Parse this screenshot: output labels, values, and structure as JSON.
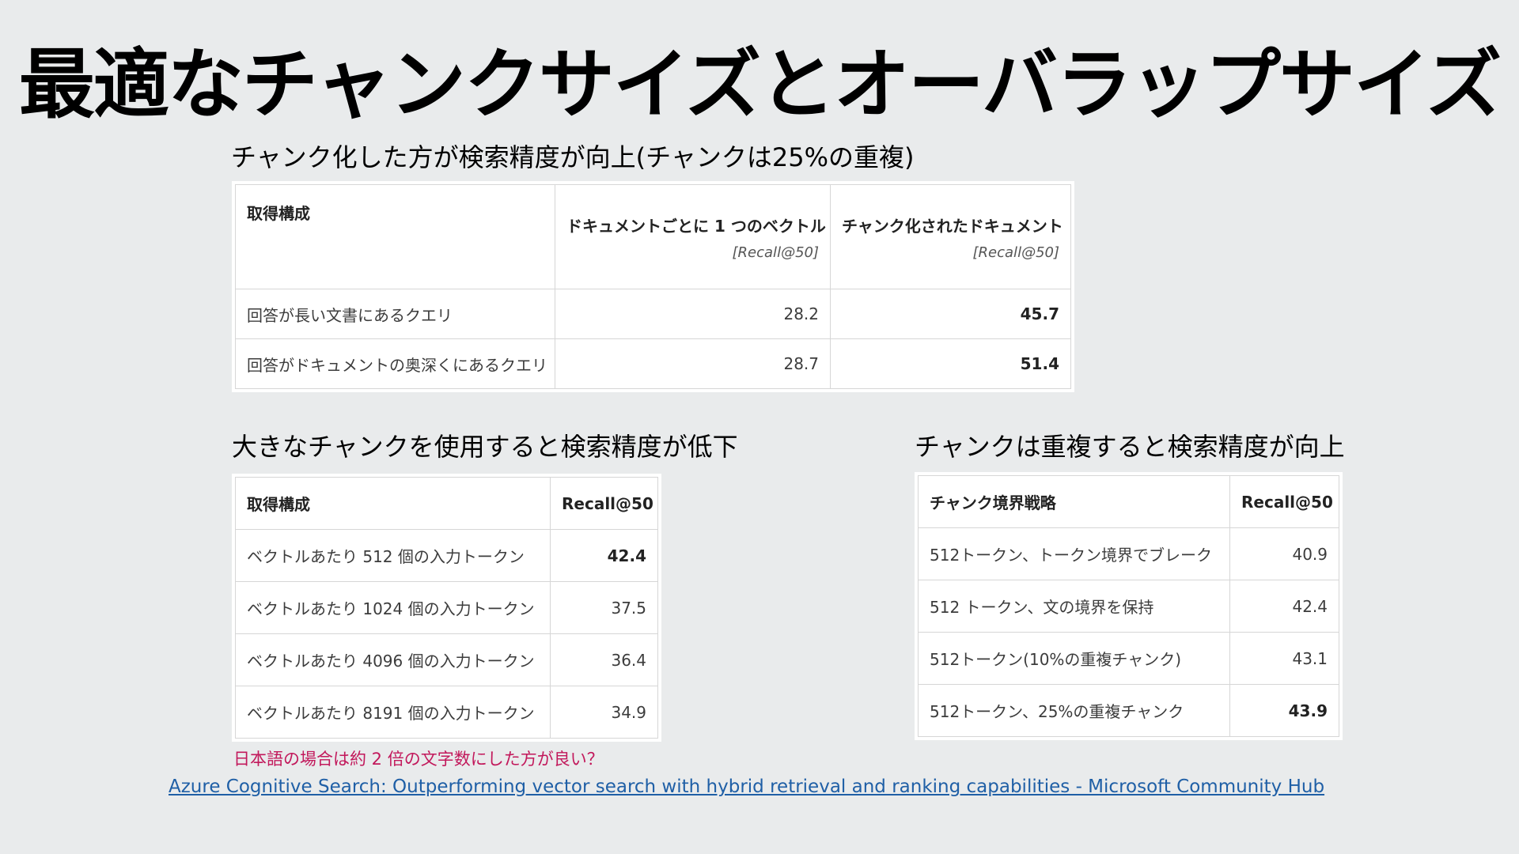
{
  "title": "最適なチャンクサイズとオーバラップサイズ",
  "section1": {
    "heading": "チャンク化した方が検索精度が向上(チャンクは25%の重複)",
    "header": {
      "config": "取得構成",
      "col1": "ドキュメントごとに 1 つのベクトル",
      "col1_sub": "[Recall@50]",
      "col2": "チャンク化されたドキュメント",
      "col2_sub": "[Recall@50]"
    },
    "rows": [
      {
        "label": "回答が長い文書にあるクエリ",
        "v1": "28.2",
        "v2": "45.7"
      },
      {
        "label": "回答がドキュメントの奥深くにあるクエリ",
        "v1": "28.7",
        "v2": "51.4"
      }
    ]
  },
  "section2": {
    "heading": "大きなチャンクを使用すると検索精度が低下",
    "header": {
      "config": "取得構成",
      "metric": "Recall@50"
    },
    "rows": [
      {
        "label": "ベクトルあたり 512 個の入力トークン",
        "value": "42.4"
      },
      {
        "label": "ベクトルあたり 1024 個の入力トークン",
        "value": "37.5"
      },
      {
        "label": "ベクトルあたり 4096 個の入力トークン",
        "value": "36.4"
      },
      {
        "label": "ベクトルあたり 8191 個の入力トークン",
        "value": "34.9"
      }
    ]
  },
  "section3": {
    "heading": "チャンクは重複すると検索精度が向上",
    "header": {
      "strategy": "チャンク境界戦略",
      "metric": "Recall@50"
    },
    "rows": [
      {
        "label": "512トークン、トークン境界でブレーク",
        "value": "40.9"
      },
      {
        "label": "512 トークン、文の境界を保持",
        "value": "42.4"
      },
      {
        "label": "512トークン(10%の重複チャンク)",
        "value": "43.1"
      },
      {
        "label": "512トークン、25%の重複チャンク",
        "value": "43.9"
      }
    ]
  },
  "note": "日本語の場合は約 2 倍の文字数にした方が良い？",
  "source_link": "Azure Cognitive Search: Outperforming vector search with hybrid retrieval and ranking capabilities - Microsoft Community Hub"
}
